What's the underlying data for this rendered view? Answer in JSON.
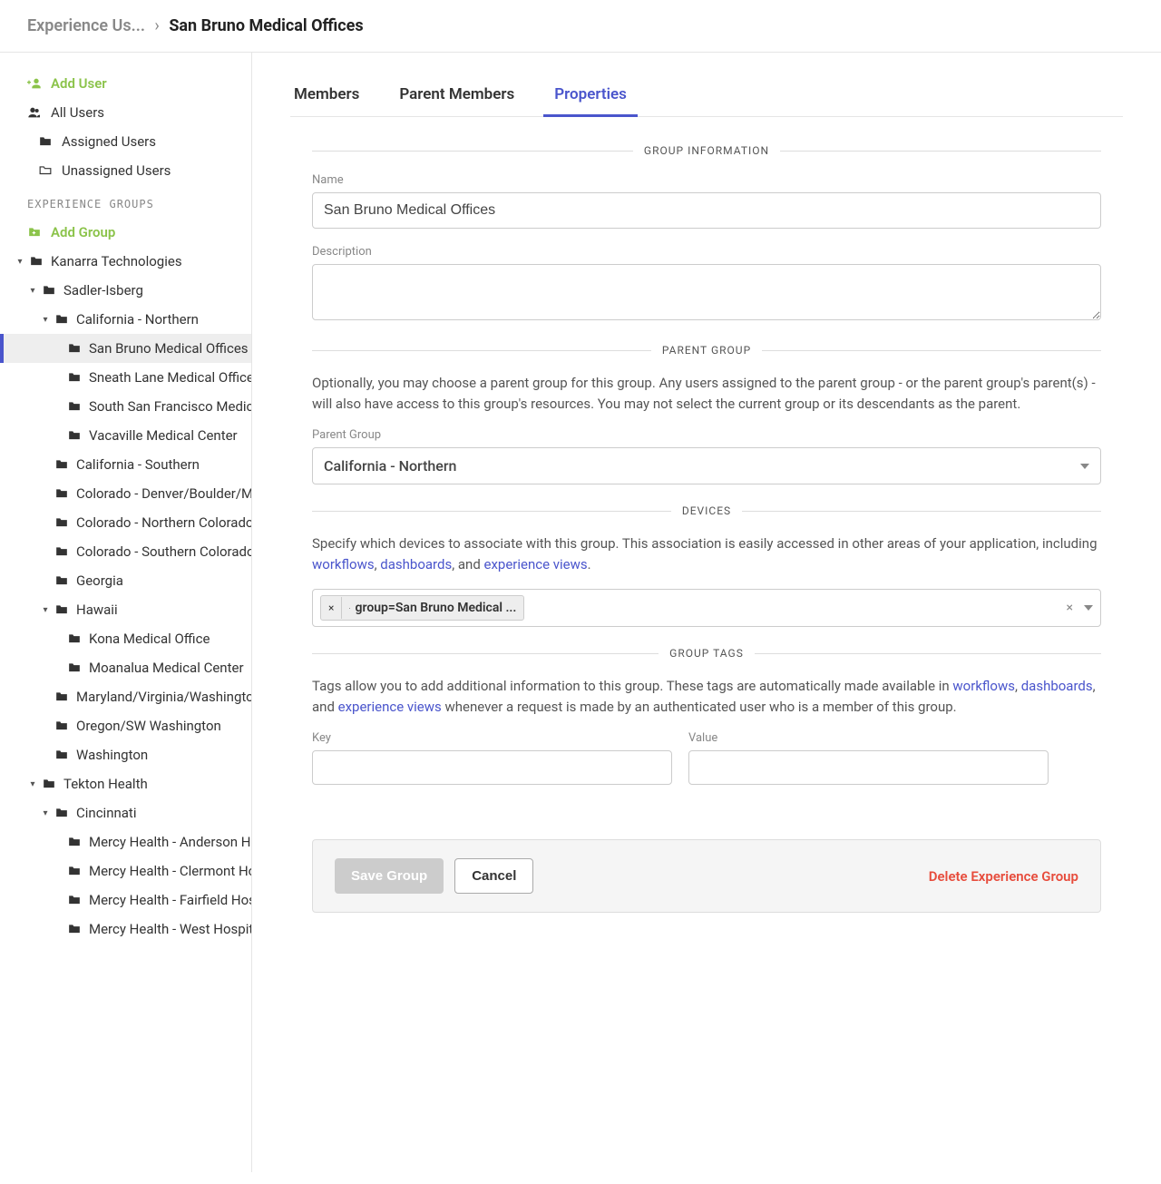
{
  "breadcrumb": {
    "parent": "Experience Us...",
    "current": "San Bruno Medical Offices"
  },
  "sidebar": {
    "add_user": "Add User",
    "all_users": "All Users",
    "assigned": "Assigned Users",
    "unassigned": "Unassigned Users",
    "groups_header": "EXPERIENCE GROUPS",
    "add_group": "Add Group"
  },
  "tree": {
    "n0": "Kanarra Technologies",
    "n1": "Sadler-Isberg",
    "n2": "California - Northern",
    "n3": "San Bruno Medical Offices",
    "n4": "Sneath Lane Medical Offices",
    "n5": "South San Francisco Medical Offices",
    "n6": "Vacaville Medical Center",
    "n7": "California - Southern",
    "n8": "Colorado - Denver/Boulder/Mountain",
    "n9": "Colorado - Northern Colorado",
    "n10": "Colorado - Southern Colorado",
    "n11": "Georgia",
    "n12": "Hawaii",
    "n13": "Kona Medical Office",
    "n14": "Moanalua Medical Center",
    "n15": "Maryland/Virginia/Washington",
    "n16": "Oregon/SW Washington",
    "n17": "Washington",
    "n18": "Tekton Health",
    "n19": "Cincinnati",
    "n20": "Mercy Health - Anderson Hospital",
    "n21": "Mercy Health - Clermont Hospital",
    "n22": "Mercy Health - Fairfield Hospital",
    "n23": "Mercy Health - West Hospital"
  },
  "tabs": {
    "members": "Members",
    "parent_members": "Parent Members",
    "properties": "Properties"
  },
  "sections": {
    "group_info": "GROUP INFORMATION",
    "parent_group": "PARENT GROUP",
    "devices": "DEVICES",
    "group_tags": "GROUP TAGS"
  },
  "fields": {
    "name_label": "Name",
    "name_value": "San Bruno Medical Offices",
    "desc_label": "Description",
    "parent_desc_1": "Optionally, you may choose a parent group for this group. Any users assigned to the parent group - or the parent group's parent(s) - will also have access to this group's resources. You may not select the current group or its descendants as the parent.",
    "parent_label": "Parent Group",
    "parent_value": "California - Northern",
    "devices_desc_pre": "Specify which devices to associate with this group. This association is easily accessed in other areas of your application, including ",
    "link_workflows": "workflows",
    "link_dashboards": "dashboards",
    "link_experience_views": "experience views",
    "devices_chip": "group=San Bruno Medical ...",
    "tags_desc_pre": "Tags allow you to add additional information to this group. These tags are automatically made available in ",
    "tags_desc_post": " whenever a request is made by an authenticated user who is a member of this group.",
    "key_label": "Key",
    "value_label": "Value"
  },
  "buttons": {
    "save": "Save Group",
    "cancel": "Cancel",
    "delete": "Delete Experience Group"
  }
}
